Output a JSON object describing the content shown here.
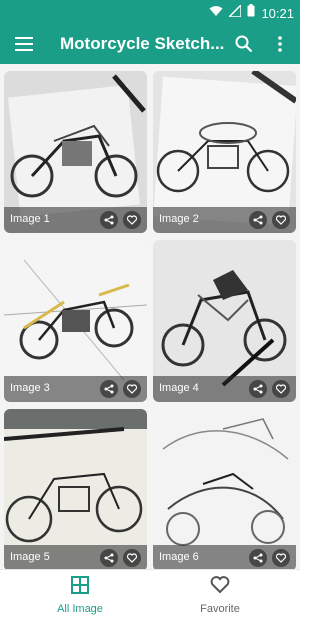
{
  "status_bar": {
    "time": "10:21"
  },
  "app_bar": {
    "title": "Motorcycle Sketch..."
  },
  "gallery": {
    "items": [
      {
        "label": "Image 1"
      },
      {
        "label": "Image 2"
      },
      {
        "label": "Image 3"
      },
      {
        "label": "Image 4"
      },
      {
        "label": "Image 5"
      },
      {
        "label": "Image 6"
      }
    ]
  },
  "bottom_nav": {
    "all_image_label": "All Image",
    "favorite_label": "Favorite"
  },
  "colors": {
    "primary": "#1a9e87",
    "active_tab": "#1a9e87",
    "inactive_tab": "#666666"
  }
}
